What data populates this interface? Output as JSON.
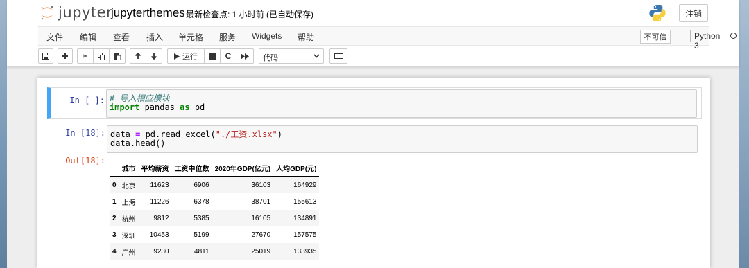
{
  "header": {
    "logo_text": "jupyter",
    "notebook_title": "jupyterthemes",
    "checkpoint": "最新检查点: 1 小时前   (已自动保存)",
    "logout": "注销"
  },
  "menu": {
    "items": [
      "文件",
      "编辑",
      "查看",
      "插入",
      "单元格",
      "服务",
      "Widgets",
      "帮助"
    ],
    "trust": "不可信",
    "kernel": "Python 3"
  },
  "toolbar": {
    "run_label": "运行",
    "cell_type": "代码"
  },
  "cells": [
    {
      "prompt": "In [ ]:",
      "lines": [
        "# 导入相应模块",
        "import pandas as pd"
      ]
    },
    {
      "prompt": "In [18]:",
      "lines": [
        "data = pd.read_excel(\"./工资.xlsx\")",
        "data.head()"
      ],
      "out_prompt": "Out[18]:"
    }
  ],
  "table": {
    "columns": [
      "城市",
      "平均薪资",
      "工资中位数",
      "2020年GDP(亿元)",
      "人均GDP(元)"
    ],
    "rows": [
      [
        "0",
        "北京",
        "11623",
        "6906",
        "36103",
        "164929"
      ],
      [
        "1",
        "上海",
        "11226",
        "6378",
        "38701",
        "155613"
      ],
      [
        "2",
        "杭州",
        "9812",
        "5385",
        "16105",
        "134891"
      ],
      [
        "3",
        "深圳",
        "10453",
        "5199",
        "27670",
        "157575"
      ],
      [
        "4",
        "广州",
        "9230",
        "4811",
        "25019",
        "133935"
      ]
    ]
  },
  "colors": {
    "selected_border": "#42a5f5",
    "in_prompt": "#303f9f",
    "out_prompt": "#d84315"
  }
}
